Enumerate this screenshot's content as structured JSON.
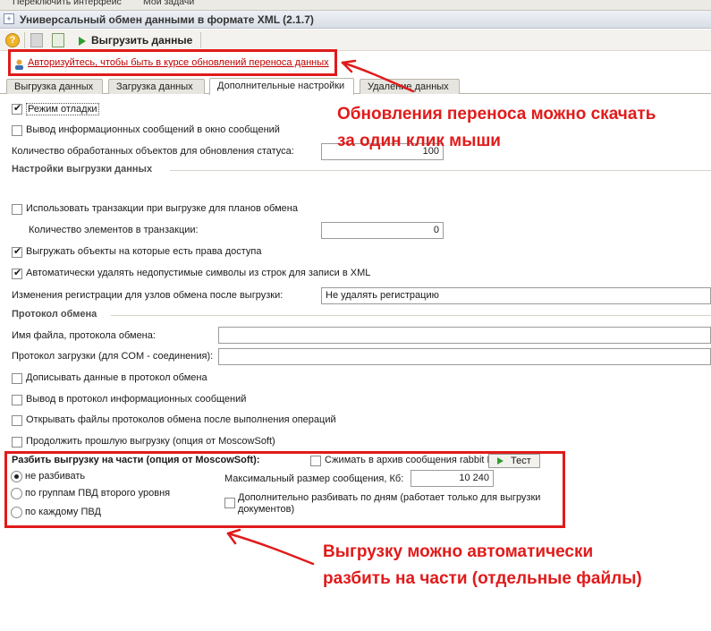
{
  "top_menu": {
    "switch_interface": "Переключить интерфейс",
    "my_tasks": "Мои задачи"
  },
  "window": {
    "title": "Универсальный обмен данными в формате XML (2.1.7)"
  },
  "toolbar": {
    "export_label": "Выгрузить данные"
  },
  "auth_link": "Авторизуйтесь, чтобы быть в курсе обновлений переноса данных",
  "tabs": [
    {
      "label": "Выгрузка данных"
    },
    {
      "label": "Загрузка данных"
    },
    {
      "label": "Дополнительные настройки"
    },
    {
      "label": "Удаление данных"
    }
  ],
  "settings": {
    "debug_mode": {
      "label": "Режим отладки",
      "checked": true
    },
    "info_messages_window": {
      "label": "Вывод информационных сообщений в окно сообщений",
      "checked": false
    },
    "processed_count_label": "Количество обработанных объектов для обновления статуса:",
    "processed_count_value": "100"
  },
  "export_settings": {
    "title": "Настройки выгрузки данных",
    "use_transactions": {
      "label": "Использовать транзакции при выгрузке для планов обмена",
      "checked": false
    },
    "items_in_transaction_label": "Количество элементов в транзакции:",
    "items_in_transaction_value": "0",
    "export_with_access": {
      "label": "Выгружать объекты на которые есть права доступа",
      "checked": true
    },
    "remove_invalid_chars": {
      "label": "Автоматически удалять недопустимые символы из строк для записи в XML",
      "checked": true
    },
    "registration_changes_label": "Изменения регистрации для узлов обмена после выгрузки:",
    "registration_changes_value": "Не удалять регистрацию"
  },
  "protocol": {
    "title": "Протокол обмена",
    "file_name_label": "Имя файла, протокола обмена:",
    "file_name_value": "",
    "load_protocol_label": "Протокол загрузки (для COM - соединения):",
    "load_protocol_value": "",
    "append_to_protocol": {
      "label": "Дописывать данные в протокол обмена",
      "checked": false
    },
    "info_messages_protocol": {
      "label": "Вывод в протокол информационных сообщений",
      "checked": false
    },
    "open_protocol_files": {
      "label": "Открывать файлы протоколов обмена после выполнения операций",
      "checked": false
    },
    "continue_export": {
      "label": "Продолжить прошлую выгрузку (опция от MoscowSoft)",
      "checked": false
    }
  },
  "split": {
    "title": "Разбить выгрузку на части (опция от MoscowSoft):",
    "compress_archive": {
      "label": "Сжимать в архив сообщения rabbit M",
      "checked": false
    },
    "test_button": "Тест",
    "options": [
      {
        "label": "не разбивать",
        "selected": true
      },
      {
        "label": "по группам ПВД второго уровня",
        "selected": false
      },
      {
        "label": "по каждому ПВД",
        "selected": false
      }
    ],
    "max_size_label": "Максимальный размер сообщения, Кб:",
    "max_size_value": "10 240",
    "split_by_days": {
      "label_line1": "Дополнительно разбивать по дням (работает только для выгрузки",
      "label_line2": "документов)",
      "checked": false
    }
  },
  "annotations": {
    "top_line1": "Обновления переноса можно скачать",
    "top_line2": "за один клик мыши",
    "bottom_line1": "Выгрузку можно автоматически",
    "bottom_line2": "разбить на части (отдельные файлы)"
  },
  "colors": {
    "annotation_red": "#e01b1b",
    "link_red": "#c00000",
    "run_green": "#2e9e2e"
  }
}
